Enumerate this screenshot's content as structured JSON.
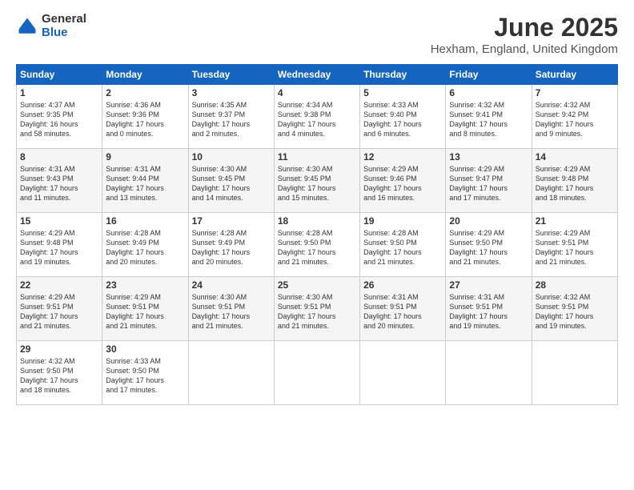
{
  "logo": {
    "general": "General",
    "blue": "Blue"
  },
  "title": {
    "month": "June 2025",
    "location": "Hexham, England, United Kingdom"
  },
  "header": {
    "days": [
      "Sunday",
      "Monday",
      "Tuesday",
      "Wednesday",
      "Thursday",
      "Friday",
      "Saturday"
    ]
  },
  "weeks": [
    [
      {
        "day": "1",
        "info": "Sunrise: 4:37 AM\nSunset: 9:35 PM\nDaylight: 16 hours\nand 58 minutes."
      },
      {
        "day": "2",
        "info": "Sunrise: 4:36 AM\nSunset: 9:36 PM\nDaylight: 17 hours\nand 0 minutes."
      },
      {
        "day": "3",
        "info": "Sunrise: 4:35 AM\nSunset: 9:37 PM\nDaylight: 17 hours\nand 2 minutes."
      },
      {
        "day": "4",
        "info": "Sunrise: 4:34 AM\nSunset: 9:38 PM\nDaylight: 17 hours\nand 4 minutes."
      },
      {
        "day": "5",
        "info": "Sunrise: 4:33 AM\nSunset: 9:40 PM\nDaylight: 17 hours\nand 6 minutes."
      },
      {
        "day": "6",
        "info": "Sunrise: 4:32 AM\nSunset: 9:41 PM\nDaylight: 17 hours\nand 8 minutes."
      },
      {
        "day": "7",
        "info": "Sunrise: 4:32 AM\nSunset: 9:42 PM\nDaylight: 17 hours\nand 9 minutes."
      }
    ],
    [
      {
        "day": "8",
        "info": "Sunrise: 4:31 AM\nSunset: 9:43 PM\nDaylight: 17 hours\nand 11 minutes."
      },
      {
        "day": "9",
        "info": "Sunrise: 4:31 AM\nSunset: 9:44 PM\nDaylight: 17 hours\nand 13 minutes."
      },
      {
        "day": "10",
        "info": "Sunrise: 4:30 AM\nSunset: 9:45 PM\nDaylight: 17 hours\nand 14 minutes."
      },
      {
        "day": "11",
        "info": "Sunrise: 4:30 AM\nSunset: 9:45 PM\nDaylight: 17 hours\nand 15 minutes."
      },
      {
        "day": "12",
        "info": "Sunrise: 4:29 AM\nSunset: 9:46 PM\nDaylight: 17 hours\nand 16 minutes."
      },
      {
        "day": "13",
        "info": "Sunrise: 4:29 AM\nSunset: 9:47 PM\nDaylight: 17 hours\nand 17 minutes."
      },
      {
        "day": "14",
        "info": "Sunrise: 4:29 AM\nSunset: 9:48 PM\nDaylight: 17 hours\nand 18 minutes."
      }
    ],
    [
      {
        "day": "15",
        "info": "Sunrise: 4:29 AM\nSunset: 9:48 PM\nDaylight: 17 hours\nand 19 minutes."
      },
      {
        "day": "16",
        "info": "Sunrise: 4:28 AM\nSunset: 9:49 PM\nDaylight: 17 hours\nand 20 minutes."
      },
      {
        "day": "17",
        "info": "Sunrise: 4:28 AM\nSunset: 9:49 PM\nDaylight: 17 hours\nand 20 minutes."
      },
      {
        "day": "18",
        "info": "Sunrise: 4:28 AM\nSunset: 9:50 PM\nDaylight: 17 hours\nand 21 minutes."
      },
      {
        "day": "19",
        "info": "Sunrise: 4:28 AM\nSunset: 9:50 PM\nDaylight: 17 hours\nand 21 minutes."
      },
      {
        "day": "20",
        "info": "Sunrise: 4:29 AM\nSunset: 9:50 PM\nDaylight: 17 hours\nand 21 minutes."
      },
      {
        "day": "21",
        "info": "Sunrise: 4:29 AM\nSunset: 9:51 PM\nDaylight: 17 hours\nand 21 minutes."
      }
    ],
    [
      {
        "day": "22",
        "info": "Sunrise: 4:29 AM\nSunset: 9:51 PM\nDaylight: 17 hours\nand 21 minutes."
      },
      {
        "day": "23",
        "info": "Sunrise: 4:29 AM\nSunset: 9:51 PM\nDaylight: 17 hours\nand 21 minutes."
      },
      {
        "day": "24",
        "info": "Sunrise: 4:30 AM\nSunset: 9:51 PM\nDaylight: 17 hours\nand 21 minutes."
      },
      {
        "day": "25",
        "info": "Sunrise: 4:30 AM\nSunset: 9:51 PM\nDaylight: 17 hours\nand 21 minutes."
      },
      {
        "day": "26",
        "info": "Sunrise: 4:31 AM\nSunset: 9:51 PM\nDaylight: 17 hours\nand 20 minutes."
      },
      {
        "day": "27",
        "info": "Sunrise: 4:31 AM\nSunset: 9:51 PM\nDaylight: 17 hours\nand 19 minutes."
      },
      {
        "day": "28",
        "info": "Sunrise: 4:32 AM\nSunset: 9:51 PM\nDaylight: 17 hours\nand 19 minutes."
      }
    ],
    [
      {
        "day": "29",
        "info": "Sunrise: 4:32 AM\nSunset: 9:50 PM\nDaylight: 17 hours\nand 18 minutes."
      },
      {
        "day": "30",
        "info": "Sunrise: 4:33 AM\nSunset: 9:50 PM\nDaylight: 17 hours\nand 17 minutes."
      },
      {
        "day": "",
        "info": ""
      },
      {
        "day": "",
        "info": ""
      },
      {
        "day": "",
        "info": ""
      },
      {
        "day": "",
        "info": ""
      },
      {
        "day": "",
        "info": ""
      }
    ]
  ]
}
